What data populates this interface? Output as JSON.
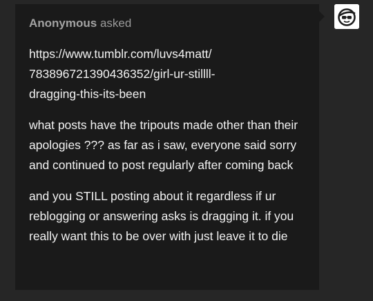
{
  "ask": {
    "asker": "Anonymous",
    "asked_label": "asked",
    "link": "https://www.tumblr.com/luvs4matt/\n783896721390436352/girl-ur-stillll-\ndragging-this-its-been",
    "paragraphs": [
      "what posts have the tripouts made other than their apologies ??? as far as i saw, everyone said sorry and continued to post regularly after coming back",
      "and you STILL posting about it regardless if ur reblogging or answering asks is dragging it. if you really want this to be over with just leave it to die"
    ]
  },
  "colors": {
    "page_background": "#262626",
    "card_background": "#1a1a1a",
    "header_text": "#9a9a9a",
    "body_text": "#f2f2f2",
    "avatar_background": "#ffffff"
  },
  "icons": {
    "avatar": "anonymous-sunglasses-avatar-icon"
  }
}
